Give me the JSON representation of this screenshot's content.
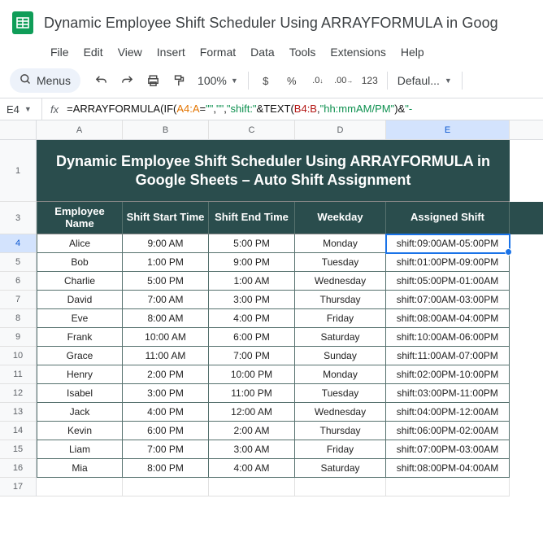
{
  "title": "Dynamic Employee Shift Scheduler Using ARRAYFORMULA in Goog",
  "menu": {
    "file": "File",
    "edit": "Edit",
    "view": "View",
    "insert": "Insert",
    "format": "Format",
    "data": "Data",
    "tools": "Tools",
    "extensions": "Extensions",
    "help": "Help"
  },
  "toolbar": {
    "menus": "Menus",
    "zoom": "100%",
    "dollar": "$",
    "percent": "%",
    "dec_dec": ".0",
    "dec_inc": ".00",
    "num_fmt": "123",
    "font": "Defaul..."
  },
  "cell_ref": "E4",
  "formula": {
    "p0": "=",
    "p1": "ARRAYFORMULA",
    "p2": "(",
    "p3": "IF",
    "p4": "(",
    "p5": "A4:A",
    "p6": "=",
    "p7": "\"\"",
    "p8": ",",
    "p9": "\"\"",
    "p10": ",",
    "p11": "\"shift:\"",
    "p12": "&",
    "p13": "TEXT",
    "p14": "(",
    "p15": "B4:B",
    "p16": ",",
    "p17": "\"hh:mmAM/PM\"",
    "p18": ")",
    "p19": "&",
    "p20": "\"-"
  },
  "col_labels": {
    "A": "A",
    "B": "B",
    "C": "C",
    "D": "D",
    "E": "E"
  },
  "row_labels": [
    "1",
    "3",
    "4",
    "5",
    "6",
    "7",
    "8",
    "9",
    "10",
    "11",
    "12",
    "13",
    "14",
    "15",
    "16",
    "17"
  ],
  "title_cell": "Dynamic Employee Shift Scheduler Using ARRAYFORMULA in Google Sheets – Auto Shift Assignment",
  "headers": {
    "A": "Employee Name",
    "B": "Shift Start Time",
    "C": "Shift End Time",
    "D": "Weekday",
    "E": "Assigned Shift"
  },
  "rows": [
    {
      "A": "Alice",
      "B": "9:00 AM",
      "C": "5:00 PM",
      "D": "Monday",
      "E": "shift:09:00AM-05:00PM"
    },
    {
      "A": "Bob",
      "B": "1:00 PM",
      "C": "9:00 PM",
      "D": "Tuesday",
      "E": "shift:01:00PM-09:00PM"
    },
    {
      "A": "Charlie",
      "B": "5:00 PM",
      "C": "1:00 AM",
      "D": "Wednesday",
      "E": "shift:05:00PM-01:00AM"
    },
    {
      "A": "David",
      "B": "7:00 AM",
      "C": "3:00 PM",
      "D": "Thursday",
      "E": "shift:07:00AM-03:00PM"
    },
    {
      "A": "Eve",
      "B": "8:00 AM",
      "C": "4:00 PM",
      "D": "Friday",
      "E": "shift:08:00AM-04:00PM"
    },
    {
      "A": "Frank",
      "B": "10:00 AM",
      "C": "6:00 PM",
      "D": "Saturday",
      "E": "shift:10:00AM-06:00PM"
    },
    {
      "A": "Grace",
      "B": "11:00 AM",
      "C": "7:00 PM",
      "D": "Sunday",
      "E": "shift:11:00AM-07:00PM"
    },
    {
      "A": "Henry",
      "B": "2:00 PM",
      "C": "10:00 PM",
      "D": "Monday",
      "E": "shift:02:00PM-10:00PM"
    },
    {
      "A": "Isabel",
      "B": "3:00 PM",
      "C": "11:00 PM",
      "D": "Tuesday",
      "E": "shift:03:00PM-11:00PM"
    },
    {
      "A": "Jack",
      "B": "4:00 PM",
      "C": "12:00 AM",
      "D": "Wednesday",
      "E": "shift:04:00PM-12:00AM"
    },
    {
      "A": "Kevin",
      "B": "6:00 PM",
      "C": "2:00 AM",
      "D": "Thursday",
      "E": "shift:06:00PM-02:00AM"
    },
    {
      "A": "Liam",
      "B": "7:00 PM",
      "C": "3:00 AM",
      "D": "Friday",
      "E": "shift:07:00PM-03:00AM"
    },
    {
      "A": "Mia",
      "B": "8:00 PM",
      "C": "4:00 AM",
      "D": "Saturday",
      "E": "shift:08:00PM-04:00AM"
    }
  ]
}
